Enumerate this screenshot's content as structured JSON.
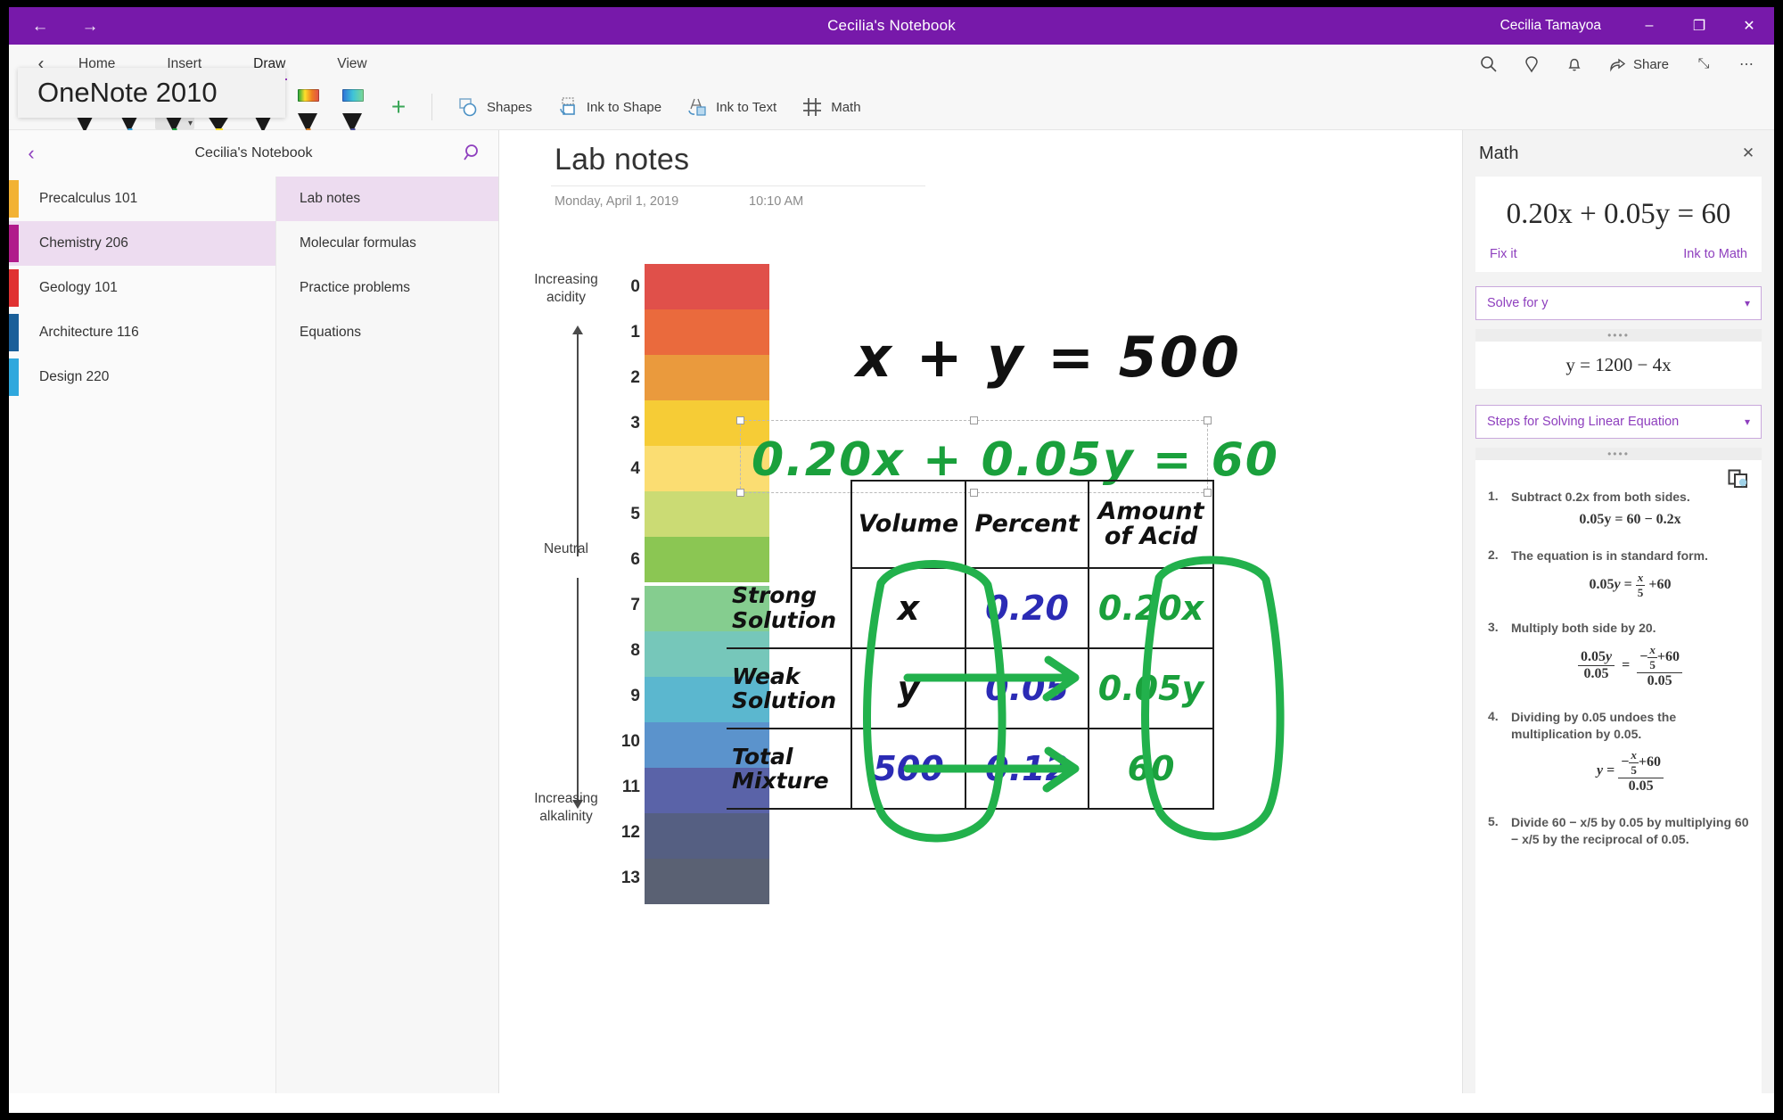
{
  "titlebar": {
    "back_label": "←",
    "forward_label": "→",
    "title": "Cecilia's Notebook",
    "user": "Cecilia Tamayoa",
    "minimize": "–",
    "restore": "❐",
    "close": "✕"
  },
  "ribbon": {
    "back_chevron": "‹",
    "tabs": [
      {
        "label": "Home",
        "active": false
      },
      {
        "label": "Insert",
        "active": false
      },
      {
        "label": "Draw",
        "active": true
      },
      {
        "label": "View",
        "active": false
      }
    ],
    "right_icons": [
      "search-icon",
      "tell-me-icon",
      "notification-icon"
    ],
    "share_label": "Share",
    "expand_icon": "⤡",
    "more_icon": "⋯"
  },
  "tooltip": {
    "text": "OneNote 2010"
  },
  "pens": [
    {
      "name": "pen-black",
      "color": "#1a1a1a",
      "wide": false,
      "selected": false
    },
    {
      "name": "pen-blue",
      "color": "#2f9fd8",
      "wide": false,
      "selected": false
    },
    {
      "name": "pen-green",
      "color": "#18a33c",
      "wide": false,
      "selected": true
    },
    {
      "name": "highlighter-yellow",
      "color": "#ffe02a",
      "wide": true,
      "selected": false
    },
    {
      "name": "pencil-gray",
      "color": "#9a9a9a",
      "wide": false,
      "selected": false
    },
    {
      "name": "pen-rainbow",
      "color": "rainbow",
      "wide": false,
      "selected": false
    },
    {
      "name": "pen-galaxy",
      "color": "galaxy",
      "wide": false,
      "selected": false
    }
  ],
  "ribbon_commands": [
    {
      "label": "Shapes",
      "icon": "shapes-icon"
    },
    {
      "label": "Ink to Shape",
      "icon": "ink-to-shape-icon"
    },
    {
      "label": "Ink to Text",
      "icon": "ink-to-text-icon"
    },
    {
      "label": "Math",
      "icon": "math-icon"
    }
  ],
  "add_pen_label": "+",
  "navpane": {
    "back": "‹",
    "title": "Cecilia's Notebook",
    "search_icon": "search-icon",
    "sections": [
      {
        "label": "Precalculus 101",
        "color": "#f2b233",
        "active": false
      },
      {
        "label": "Chemistry 206",
        "color": "#b01b8b",
        "active": true
      },
      {
        "label": "Geology 101",
        "color": "#e03131",
        "active": false
      },
      {
        "label": "Architecture 116",
        "color": "#1a5f99",
        "active": false
      },
      {
        "label": "Design 220",
        "color": "#2fa8dd",
        "active": false
      }
    ],
    "pages": [
      {
        "label": "Lab notes",
        "active": true
      },
      {
        "label": "Molecular formulas",
        "active": false
      },
      {
        "label": "Practice problems",
        "active": false
      },
      {
        "label": "Equations",
        "active": false
      }
    ]
  },
  "page": {
    "title": "Lab notes",
    "date": "Monday, April 1, 2019",
    "time": "10:10 AM"
  },
  "ph_scale": {
    "top_label": "Increasing\nacidity",
    "mid_label": "Neutral",
    "bottom_label": "Increasing\nalkalinity",
    "levels": [
      {
        "value": "0",
        "color": "#e0504a"
      },
      {
        "value": "1",
        "color": "#ea6a3d"
      },
      {
        "value": "2",
        "color": "#ea9a3d"
      },
      {
        "value": "3",
        "color": "#f6cc36"
      },
      {
        "value": "4",
        "color": "#fbdd72"
      },
      {
        "value": "5",
        "color": "#cbdb74"
      },
      {
        "value": "6",
        "color": "#8bc653"
      },
      {
        "value": "7",
        "color": "#85cd8f"
      },
      {
        "value": "8",
        "color": "#76c7ba"
      },
      {
        "value": "9",
        "color": "#5bb7cf"
      },
      {
        "value": "10",
        "color": "#5b93cc"
      },
      {
        "value": "11",
        "color": "#5a63a8"
      },
      {
        "value": "12",
        "color": "#555f82"
      },
      {
        "value": "13",
        "color": "#5a6173"
      }
    ]
  },
  "ink": {
    "equation_1": "x + y = 500",
    "equation_2": "0.20x + 0.05y = 60"
  },
  "ink_table": {
    "columns": [
      "Volume",
      "Percent",
      "Amount\nof Acid"
    ],
    "rows": [
      {
        "label": "Strong\nSolution",
        "volume": "x",
        "percent": "0.20",
        "acid": "0.20x"
      },
      {
        "label": "Weak\nSolution",
        "volume": "y",
        "percent": "0.05",
        "acid": "0.05y"
      },
      {
        "label": "Total\nMixture",
        "volume": "500",
        "percent": "0.12",
        "acid": "60"
      }
    ]
  },
  "math_pane": {
    "title": "Math",
    "close": "✕",
    "equation": "0.20x + 0.05y = 60",
    "fix_it": "Fix it",
    "ink_to_math": "Ink to Math",
    "solve_select": "Solve for y",
    "chevron": "∨",
    "grip": "••••",
    "result": "y = 1200 − 4x",
    "steps_select": "Steps for Solving Linear Equation",
    "copy_icon": "copy-icon",
    "steps": [
      {
        "n": "1.",
        "text": "Subtract 0.2x from both sides.",
        "math_kind": "plain",
        "math": "0.05y = 60 − 0.2x"
      },
      {
        "n": "2.",
        "text": "The equation is in standard form.",
        "math_kind": "frac_x5_plus60"
      },
      {
        "n": "3.",
        "text": "Multiply both side by 20.",
        "math_kind": "double_frac"
      },
      {
        "n": "4.",
        "text": "Dividing by 0.05 undoes the multiplication by 0.05.",
        "math_kind": "y_frac"
      },
      {
        "n": "5.",
        "text": "Divide 60 − x/5 by 0.05 by multiplying 60 − x/5 by the reciprocal of 0.05.",
        "math_kind": "none"
      }
    ]
  }
}
